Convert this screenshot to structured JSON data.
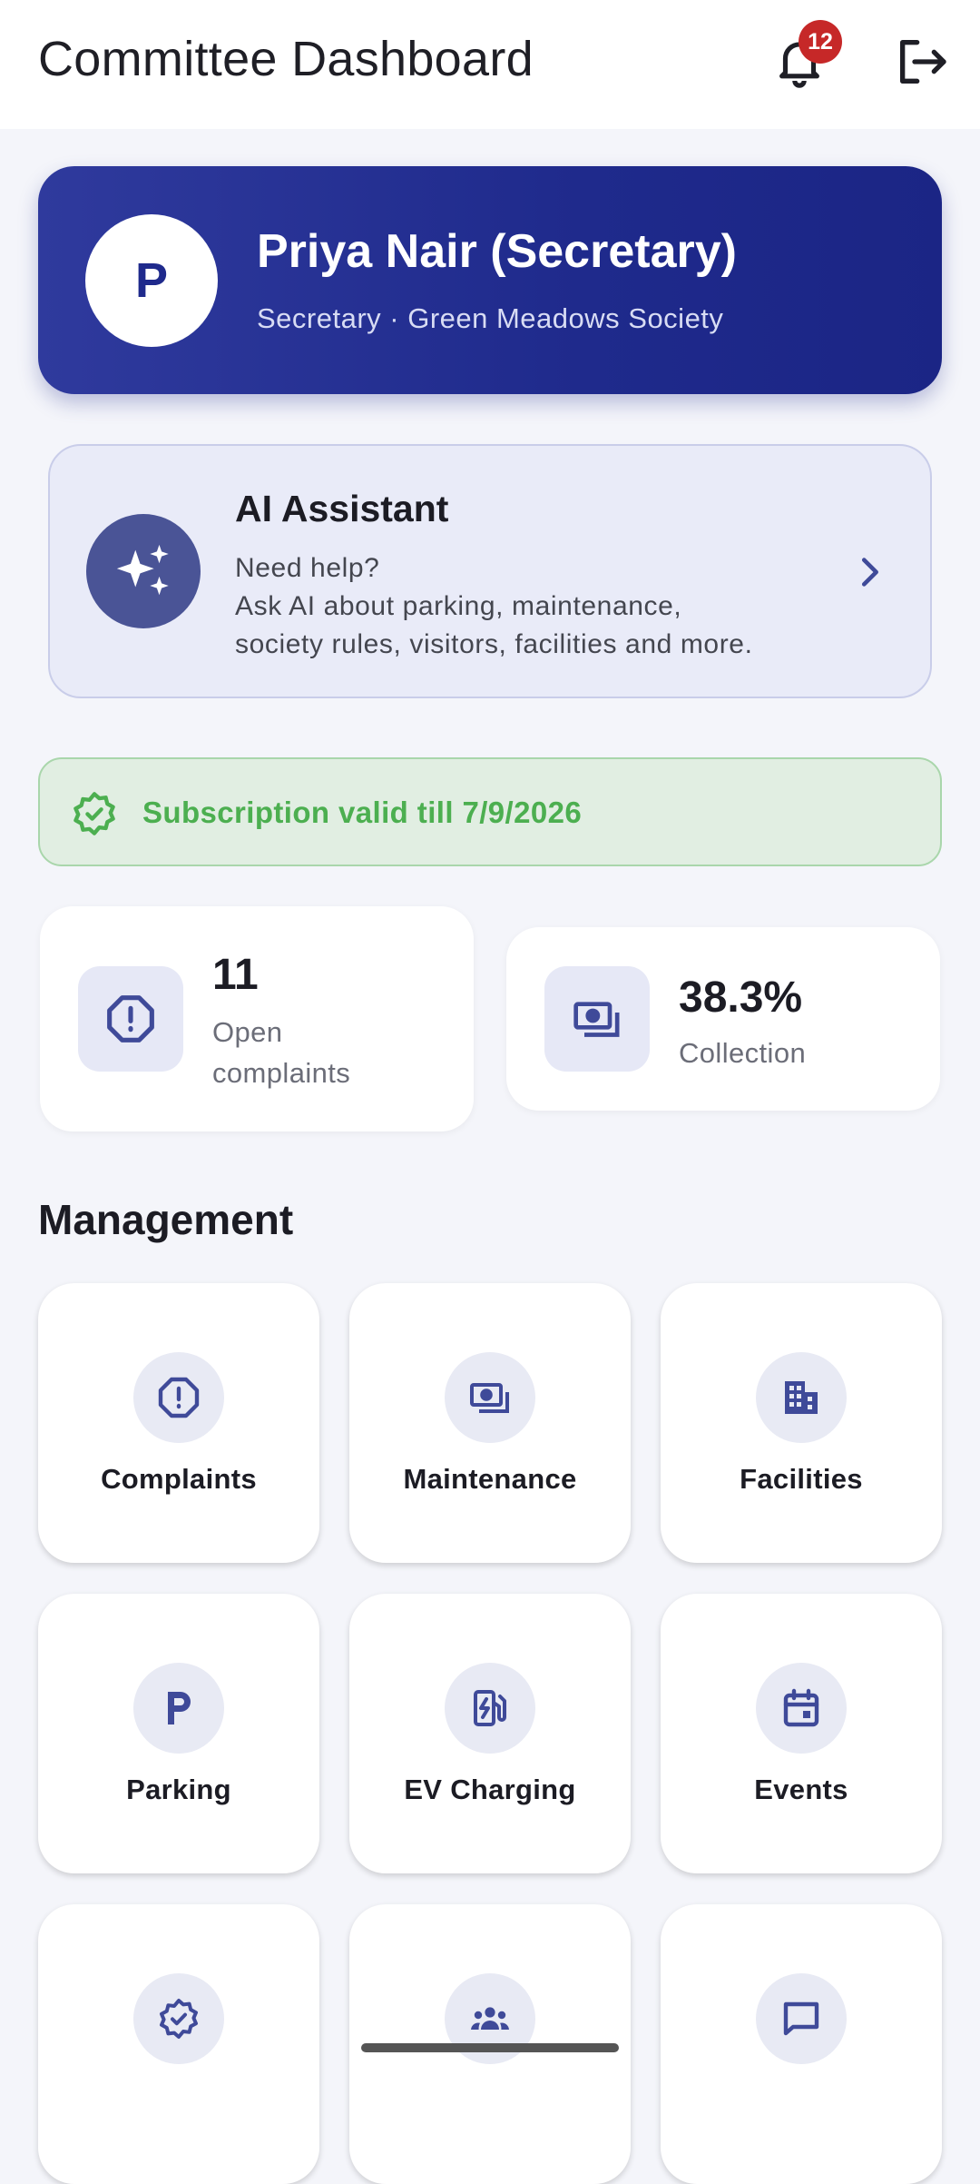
{
  "appbar": {
    "title": "Committee Dashboard",
    "notification_count": "12",
    "icons": {
      "notifications": "bell-icon",
      "logout": "logout-icon"
    }
  },
  "profile": {
    "initial": "P",
    "name": "Priya Nair (Secretary)",
    "subtitle": "Secretary · Green Meadows Society"
  },
  "ai_assistant": {
    "title": "AI Assistant",
    "lines": [
      "Need help?",
      "Ask AI about parking, maintenance,",
      "society rules, visitors, facilities and more."
    ],
    "icon": "sparkles-icon"
  },
  "subscription": {
    "text": "Subscription valid till 7/9/2026",
    "icon": "verified-badge-icon"
  },
  "stats": [
    {
      "value": "11",
      "label_line1": "Open",
      "label_line2": "complaints",
      "icon": "alert-octagon-icon"
    },
    {
      "value": "38.3%",
      "label": "Collection",
      "icon": "payments-icon"
    }
  ],
  "management": {
    "title": "Management",
    "tiles": [
      {
        "label": "Complaints",
        "icon": "alert-octagon-icon"
      },
      {
        "label": "Maintenance",
        "icon": "payments-icon"
      },
      {
        "label": "Facilities",
        "icon": "building-icon"
      },
      {
        "label": "Parking",
        "icon": "parking-icon"
      },
      {
        "label": "EV Charging",
        "icon": "ev-station-icon"
      },
      {
        "label": "Events",
        "icon": "calendar-icon"
      },
      {
        "label": "",
        "icon": "verified-badge-icon"
      },
      {
        "label": "",
        "icon": "group-icon"
      },
      {
        "label": "",
        "icon": "chat-bubble-icon"
      }
    ]
  },
  "colors": {
    "primary": "#1f2a8c",
    "icon_tint": "#3f4a99",
    "success": "#4caf50",
    "badge": "#c62828",
    "background": "#f4f5fa"
  }
}
